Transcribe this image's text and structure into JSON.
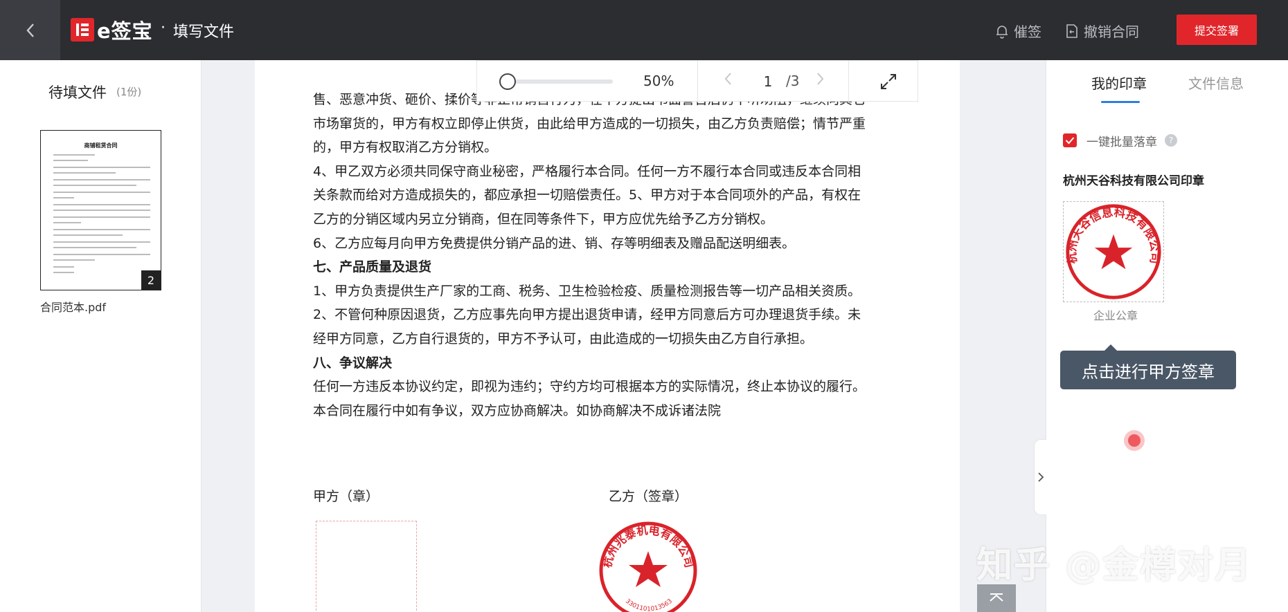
{
  "header": {
    "logo_text": "e签宝",
    "separator": "·",
    "title": "填写文件",
    "remind_label": "催签",
    "revoke_label": "撤销合同",
    "submit_label": "提交签署"
  },
  "left_panel": {
    "title": "待填文件",
    "count": "(1份)",
    "file": {
      "name": "合同范本.pdf",
      "page_badge": "2",
      "thumb_title": "商铺租赁合同"
    }
  },
  "toolbar": {
    "zoom": "50%",
    "zoom_level": 0.1,
    "page_current": "1",
    "page_total": "/3"
  },
  "document": {
    "lines": [
      {
        "text": "售、恶意冲货、砸价、揉价等非正常销售行为，在甲方提出书面警告后仍不听劝阻，继续向其它",
        "bold": false
      },
      {
        "text": "市场窜货的，甲方有权立即停止供货，由此给甲方造成的一切损失，由乙方负责赔偿；情节严重",
        "bold": false
      },
      {
        "text": "的，甲方有权取消乙方分销权。",
        "bold": false
      },
      {
        "text": "4、甲乙双方必须共同保守商业秘密，严格履行本合同。任何一方不履行本合同或违反本合同相",
        "bold": false
      },
      {
        "text": "关条款而给对方造成损失的，都应承担一切赔偿责任。5、甲方对于本合同项外的产品，有权在",
        "bold": false
      },
      {
        "text": "乙方的分销区域内另立分销商，但在同等条件下，甲方应优先给予乙方分销权。",
        "bold": false
      },
      {
        "text": "6、乙方应每月向甲方免费提供分销产品的进、销、存等明细表及赠品配送明细表。",
        "bold": false
      },
      {
        "text": "七、产品质量及退货",
        "bold": true
      },
      {
        "text": "1、甲方负责提供生产厂家的工商、税务、卫生检验检疫、质量检测报告等一切产品相关资质。",
        "bold": false
      },
      {
        "text": "2、不管何种原因退货，乙方应事先向甲方提出退货申请，经甲方同意后方可办理退货手续。未",
        "bold": false
      },
      {
        "text": "经甲方同意，乙方自行退货的，甲方不予认可，由此造成的一切损失由乙方自行承担。",
        "bold": false
      },
      {
        "text": "八、争议解决",
        "bold": true
      },
      {
        "text": "任何一方违反本协议约定，即视为违约；守约方均可根据本方的实际情况，终止本协议的履行。",
        "bold": false
      },
      {
        "text": "本合同在履行中如有争议，双方应协商解决。如协商解决不成诉诸法院",
        "bold": false
      }
    ],
    "party_a": "甲方（章）",
    "party_b": "乙方（签章）",
    "seal_b_text": "杭州兆泰机电有限公司",
    "seal_b_number": "3301101013563"
  },
  "right_panel": {
    "tab_active": "我的印章",
    "tab_inactive": "文件信息",
    "batch_label": "一键批量落章",
    "company_label": "杭州天谷科技有限公司印章",
    "seal_text": "杭州天谷信息科技有限公司",
    "seal_label": "企业公章",
    "tooltip": "点击进行甲方签章"
  },
  "watermark": "知乎 @金樽对月",
  "colors": {
    "brand_red": "#e0262b",
    "topbar": "#2b2d31",
    "accent_blue": "#2f7de1",
    "tooltip_bg": "#4a5767"
  }
}
